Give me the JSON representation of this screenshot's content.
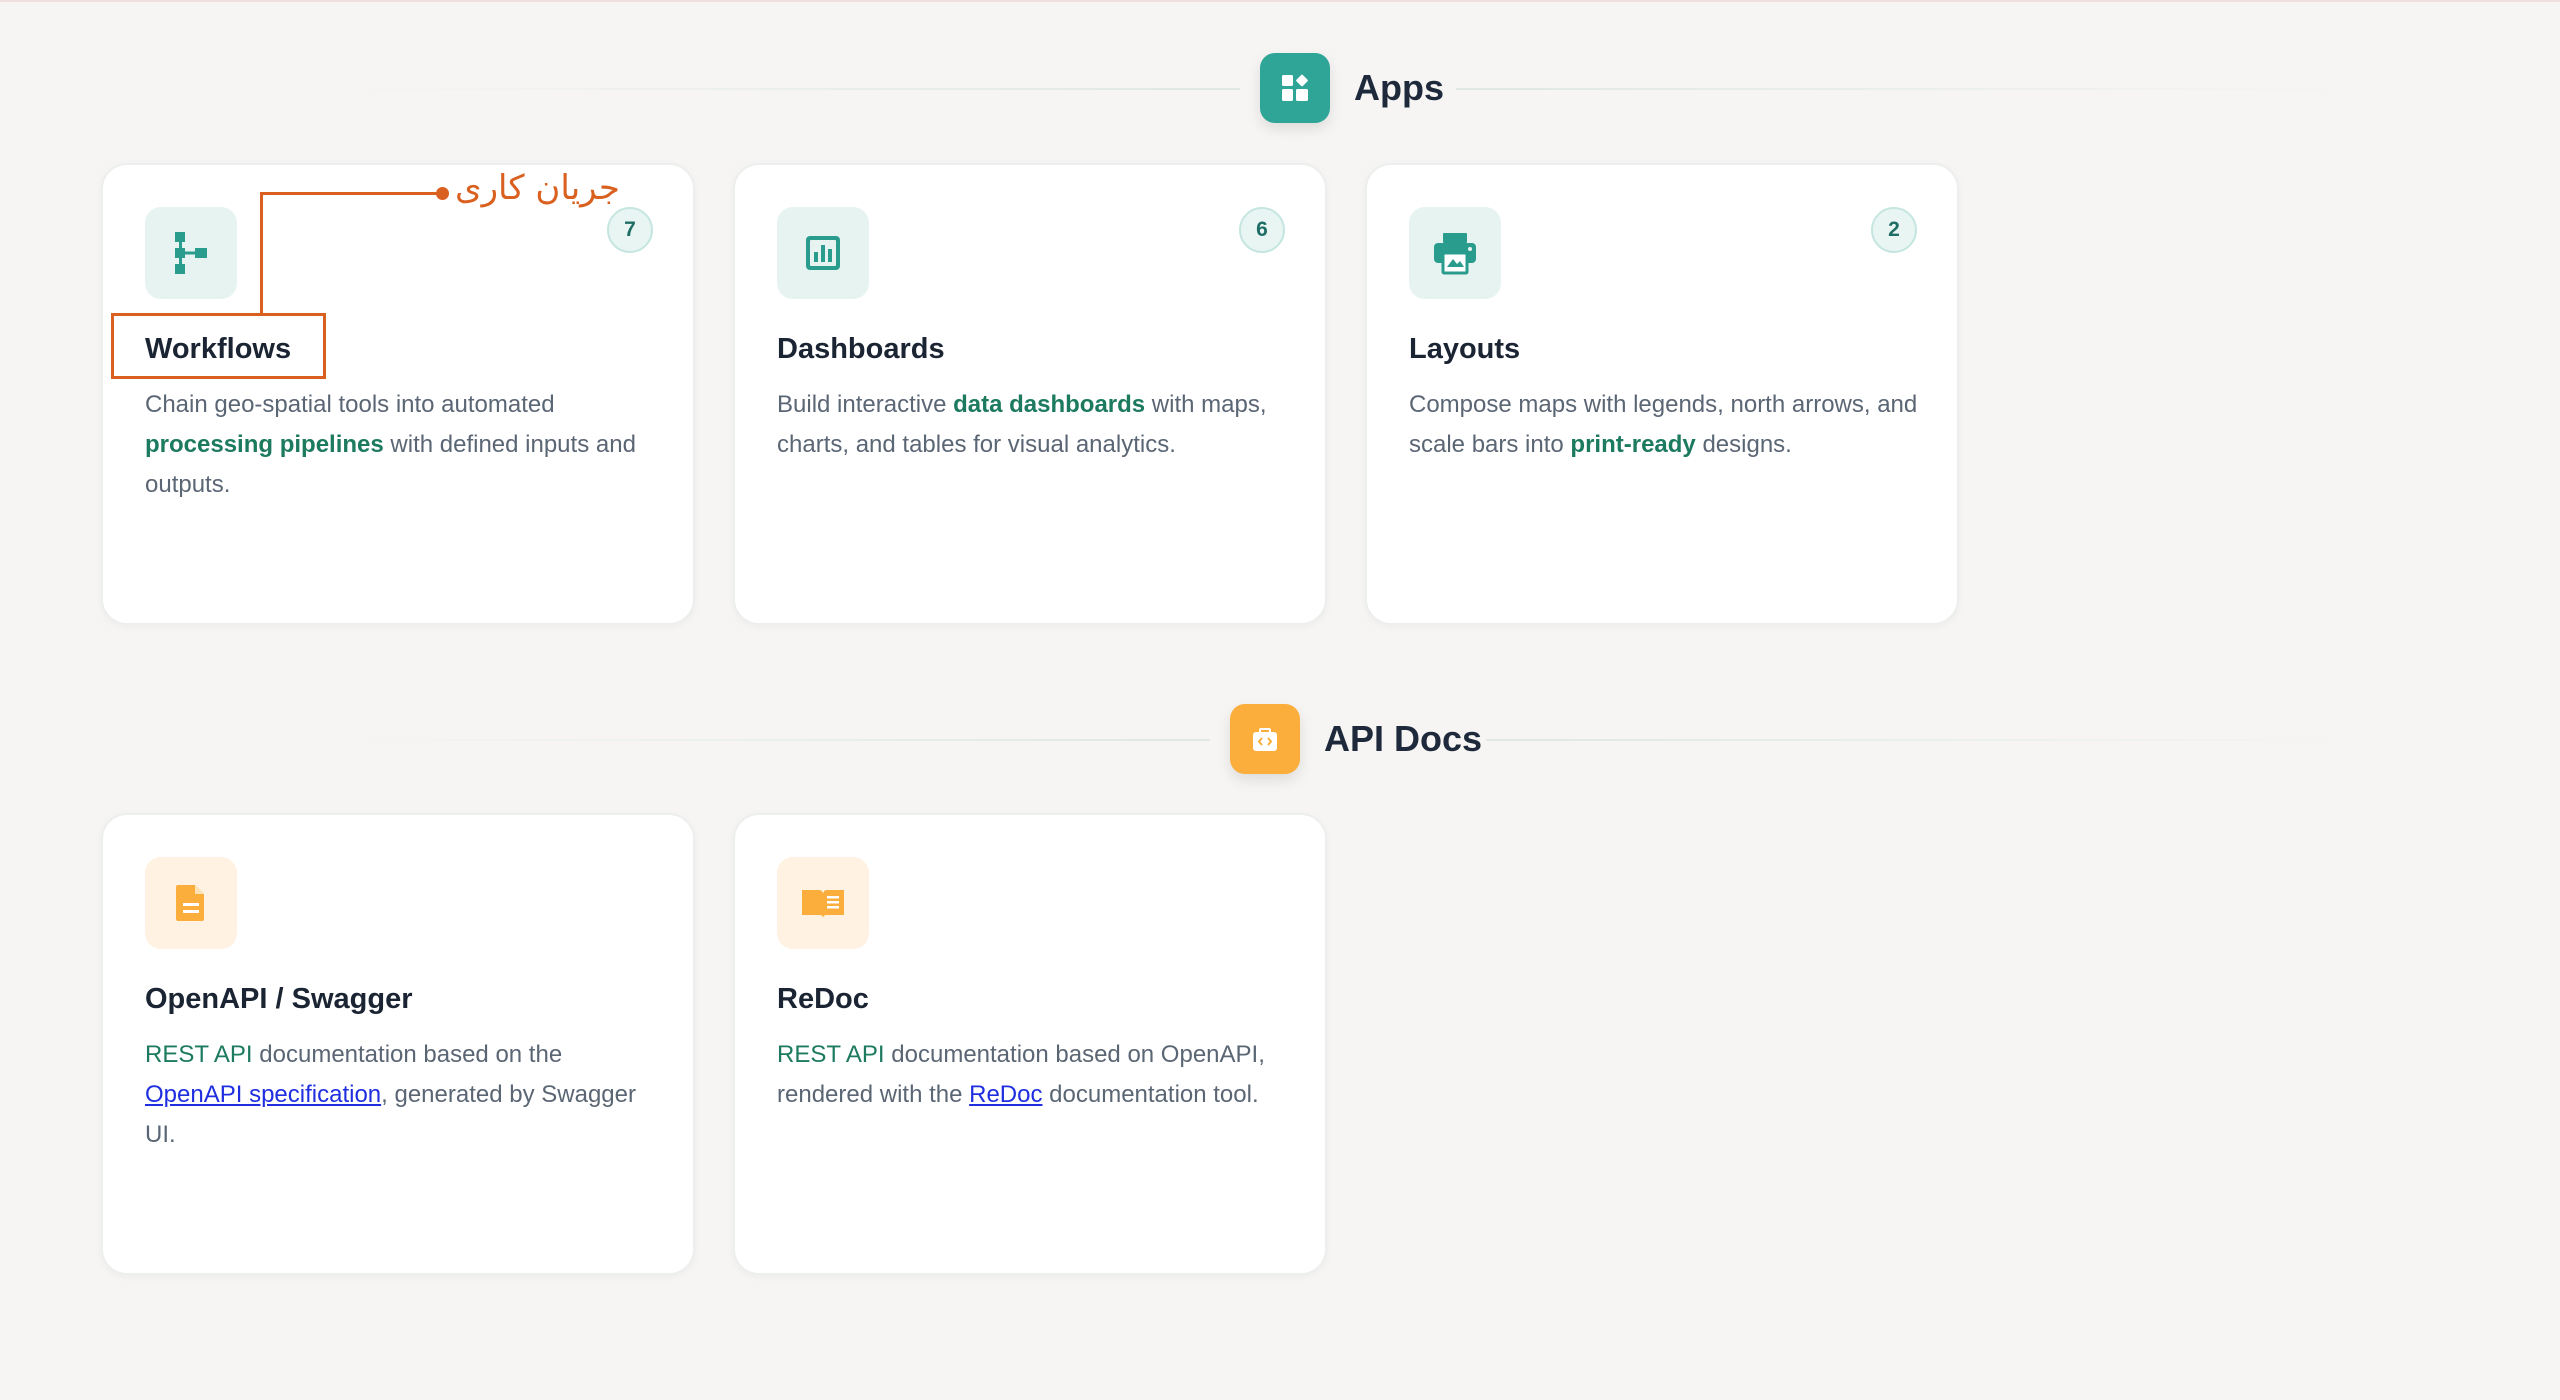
{
  "sections": {
    "apps": {
      "title": "Apps",
      "icon": "apps-grid-icon",
      "accent": "#2ea597"
    },
    "api_docs": {
      "title": "API Docs",
      "icon": "code-bag-icon",
      "accent": "#fbae3c"
    }
  },
  "apps_cards": [
    {
      "icon": "workflow-icon",
      "title": "Workflows",
      "badge": "7",
      "desc": {
        "t1": "Chain geo-spatial tools into automated ",
        "hl": "processing pipelines",
        "t2": " with defined inputs and outputs."
      }
    },
    {
      "icon": "chart-icon",
      "title": "Dashboards",
      "badge": "6",
      "desc": {
        "t1": "Build interactive ",
        "hl": "data dashboards",
        "t2": " with maps, charts, and tables for visual analytics."
      }
    },
    {
      "icon": "printer-icon",
      "title": "Layouts",
      "badge": "2",
      "desc": {
        "t1": "Compose maps with legends, north arrows, and scale bars into ",
        "hl": "print-ready",
        "t2": " designs."
      }
    }
  ],
  "docs_cards": [
    {
      "icon": "document-icon",
      "title": "OpenAPI / Swagger",
      "desc": {
        "hl": "REST API",
        "t1": " documentation based on the ",
        "link": "OpenAPI specification",
        "t2": ", generated by Swagger UI."
      }
    },
    {
      "icon": "book-icon",
      "title": "ReDoc",
      "desc": {
        "hl": "REST API",
        "t1": " documentation based on OpenAPI, rendered with the ",
        "link": "ReDoc",
        "t2": " documentation tool."
      }
    }
  ],
  "annotation": {
    "text": "جریان کاری",
    "color": "#d9601f"
  }
}
